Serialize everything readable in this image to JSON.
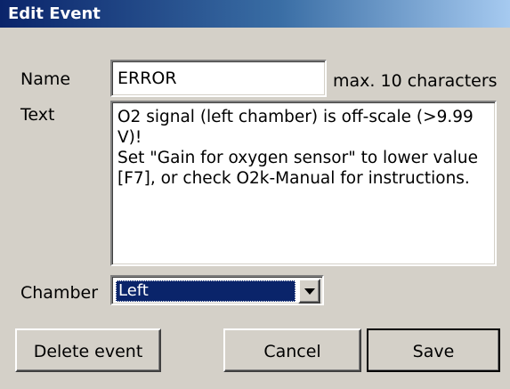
{
  "window": {
    "title": "Edit Event"
  },
  "form": {
    "name_label": "Name",
    "name_value": "ERROR",
    "name_hint": "max. 10 characters",
    "text_label": "Text",
    "text_value": "O2 signal (left chamber) is off-scale (>9.99\nV)!\nSet \"Gain for oxygen sensor\" to lower value\n[F7], or check O2k-Manual for instructions.",
    "chamber_label": "Chamber",
    "chamber_value": "Left",
    "chamber_icon": "chevron-down-icon"
  },
  "buttons": {
    "delete_label": "Delete event",
    "cancel_label": "Cancel",
    "save_label": "Save"
  },
  "colors": {
    "titlebar_start": "#0a246a",
    "titlebar_end": "#a6caf0",
    "window_bg": "#d4d0c8",
    "selection_bg": "#0a246a"
  }
}
